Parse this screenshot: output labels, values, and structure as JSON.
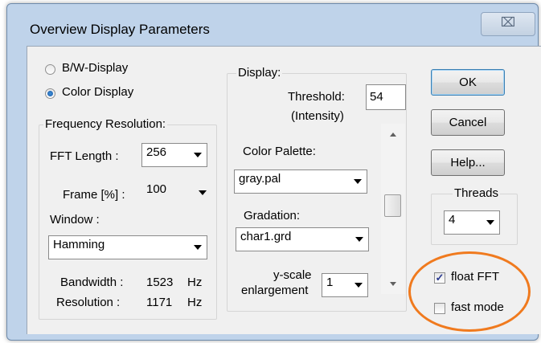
{
  "window": {
    "title": "Overview Display Parameters",
    "close_glyph": "⌧"
  },
  "display_mode": {
    "bw_label": "B/W-Display",
    "color_label": "Color Display",
    "selected": "color"
  },
  "frequency_resolution": {
    "group_label": "Frequency Resolution:",
    "fft_length_label": "FFT Length :",
    "fft_length_value": "256",
    "frame_label": "Frame [%] :",
    "frame_value": "100",
    "window_label": "Window :",
    "window_value": "Hamming",
    "bandwidth_label": "Bandwidth :",
    "bandwidth_value": "1523",
    "bandwidth_unit": "Hz",
    "resolution_label": "Resolution :",
    "resolution_value": "1171",
    "resolution_unit": "Hz"
  },
  "display": {
    "group_label": "Display:",
    "threshold_label": "Threshold:",
    "threshold_sub": "(Intensity)",
    "threshold_value": "54",
    "palette_label": "Color Palette:",
    "palette_value": "gray.pal",
    "gradation_label": "Gradation:",
    "gradation_value": "char1.grd",
    "yscale_label_1": "y-scale",
    "yscale_label_2": "enlargement",
    "yscale_value": "1"
  },
  "buttons": {
    "ok": "OK",
    "cancel": "Cancel",
    "help": "Help..."
  },
  "threads": {
    "group_label": "Threads",
    "value": "4"
  },
  "options": {
    "float_fft_label": "float FFT",
    "float_fft_checked": true,
    "fast_mode_label": "fast mode",
    "fast_mode_checked": false
  },
  "colors": {
    "highlight": "#f07a1e",
    "frame": "#bfd3ea",
    "dialog_bg": "#f0f0f0"
  }
}
